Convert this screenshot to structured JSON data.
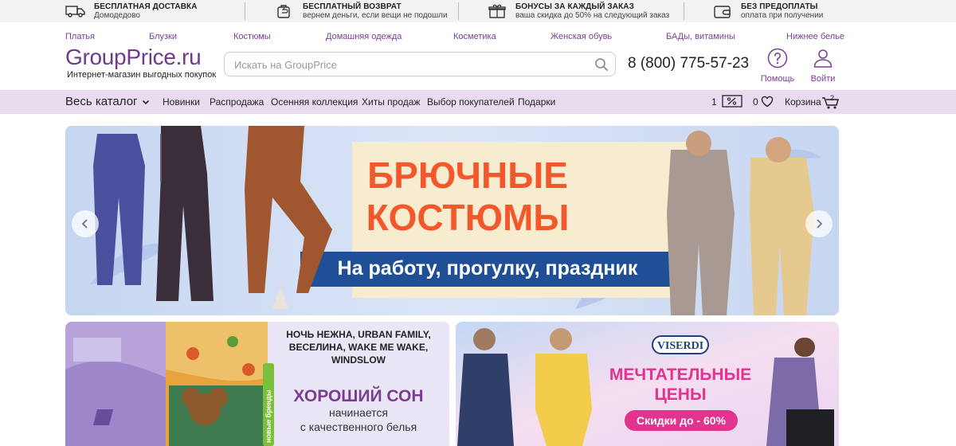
{
  "topbar": [
    {
      "title": "БЕСПЛАТНАЯ ДОСТАВКА",
      "sub": "Домодедово",
      "icon": "truck-icon"
    },
    {
      "title": "БЕСПЛАТНЫЙ ВОЗВРАТ",
      "sub": "вернем деньги, если вещи не подошли",
      "icon": "return-icon"
    },
    {
      "title": "БОНУСЫ ЗА КАЖДЫЙ ЗАКАЗ",
      "sub": "ваша скидка до 50% на следующий заказ",
      "icon": "gift-icon"
    },
    {
      "title": "БЕЗ ПРЕДОПЛАТЫ",
      "sub": "оплата при получении",
      "icon": "wallet-icon"
    }
  ],
  "categories": [
    "Платья",
    "Блузки",
    "Костюмы",
    "Домашняя одежда",
    "Косметика",
    "Женская обувь",
    "БАДы, витамины",
    "Нижнее белье"
  ],
  "header": {
    "logo": "GroupPrice.ru",
    "tagline": "Интернет-магазин выгодных покупок",
    "search_placeholder": "Искать на GroupPrice",
    "phone": "8 (800) 775-57-23",
    "help_label": "Помощь",
    "login_label": "Войти"
  },
  "nav": {
    "catalog": "Весь каталог",
    "links": [
      "Новинки",
      "Распродажа",
      "Осенняя коллекция",
      "Хиты продаж",
      "Выбор покупателей",
      "Подарки"
    ],
    "discount_count": "1",
    "favorites_count": "0",
    "cart_label": "Корзина",
    "cart_count": "2"
  },
  "hero": {
    "title_line1": "БРЮЧНЫЕ",
    "title_line2": "КОСТЮМЫ",
    "subtitle": "На работу, прогулку, праздник"
  },
  "promo_left": {
    "brands_line1": "НОЧЬ НЕЖНА, URBAN FAMILY,",
    "brands_line2": "ВЕСЕЛИНА, WAKE ME WAKE,",
    "brands_line3": "WINDSLOW",
    "title": "ХОРОШИЙ СОН",
    "sub_line1": "начинается",
    "sub_line2": "с качественного белья",
    "tag": "новые бренды"
  },
  "promo_right": {
    "brand": "VISERDI",
    "title_line1": "МЕЧТАТЕЛЬНЫЕ",
    "title_line2": "ЦЕНЫ",
    "badge": "Скидки до - 60%"
  },
  "colors": {
    "accent": "#7a3d91",
    "nav_bg": "#e9dcf1",
    "hero_title": "#f2582c",
    "hero_ribbon": "#1f4f97"
  }
}
